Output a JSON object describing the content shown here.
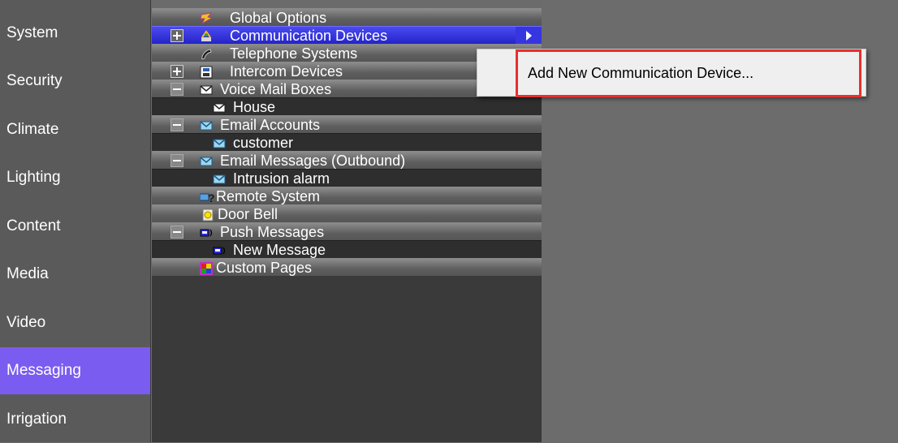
{
  "sidebar": {
    "items": [
      {
        "label": "System"
      },
      {
        "label": "Security"
      },
      {
        "label": "Climate"
      },
      {
        "label": "Lighting"
      },
      {
        "label": "Content"
      },
      {
        "label": "Media"
      },
      {
        "label": "Video"
      },
      {
        "label": "Messaging",
        "selected": true
      },
      {
        "label": "Irrigation"
      }
    ]
  },
  "tree": {
    "items": [
      {
        "label": "Global Options",
        "icon": "global-options-icon"
      },
      {
        "label": "Communication Devices",
        "icon": "communication-devices-icon",
        "expander": "plus",
        "selected": true
      },
      {
        "label": "Telephone Systems",
        "icon": "telephone-icon"
      },
      {
        "label": "Intercom Devices",
        "icon": "intercom-icon",
        "expander": "plus"
      },
      {
        "label": "Voice Mail Boxes",
        "icon": "envelope-icon",
        "expander": "minus"
      },
      {
        "label": "House",
        "icon": "envelope-icon"
      },
      {
        "label": "Email Accounts",
        "icon": "email-icon",
        "expander": "minus"
      },
      {
        "label": "customer",
        "icon": "email-icon"
      },
      {
        "label": "Email Messages (Outbound)",
        "icon": "email-icon",
        "expander": "minus"
      },
      {
        "label": "Intrusion alarm",
        "icon": "email-icon"
      },
      {
        "label": "Remote System",
        "icon": "remote-system-icon"
      },
      {
        "label": "Door Bell",
        "icon": "door-bell-icon"
      },
      {
        "label": "Push Messages",
        "icon": "push-message-icon",
        "expander": "minus"
      },
      {
        "label": "New Message",
        "icon": "push-message-icon"
      },
      {
        "label": "Custom Pages",
        "icon": "custom-pages-icon"
      }
    ]
  },
  "context_menu": {
    "item": "Add New Communication Device..."
  },
  "colors": {
    "sidebar_selected": "#7a5cf0",
    "tree_selected": "#3636e0",
    "menu_highlight_border": "#e8302c"
  }
}
